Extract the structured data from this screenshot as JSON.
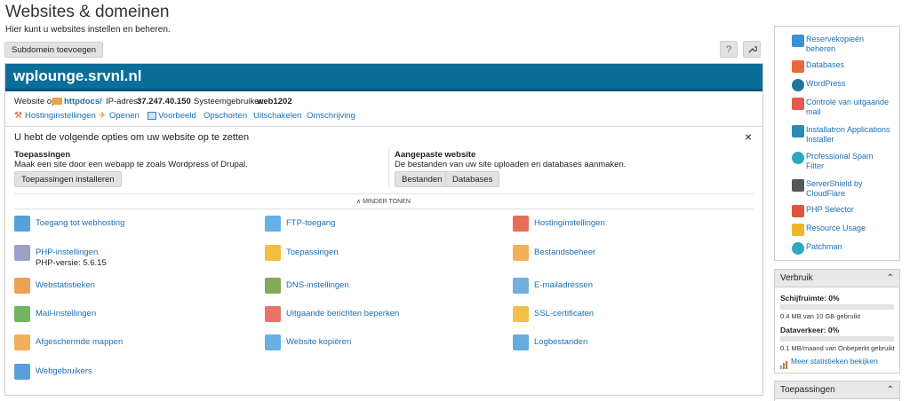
{
  "page": {
    "title": "Websites & domeinen",
    "subtitle": "Hier kunt u websites instellen en beheren."
  },
  "toolbar": {
    "add_subdomain_label": "Subdomein toevoegen",
    "help_label": "?",
    "tools_icon": "wrench-icon"
  },
  "domain": {
    "name": "wplounge.srvnl.nl",
    "website_on_label": "Website op",
    "docroot": "httpdocs/",
    "ip_label": "IP-adres:",
    "ip": "37.247.40.150",
    "sysuser_label": "Systeemgebruiker:",
    "sysuser": "web1202",
    "actions": [
      "Hostinginstellingen",
      "Openen",
      "Voorbeeld",
      "Opschorten",
      "Uitschakelen",
      "Omschrijving"
    ]
  },
  "setup": {
    "heading": "U hebt de volgende opties om uw website op te zetten",
    "close": "×",
    "apps_title": "Toepassingen",
    "apps_desc": "Maak een site door een webapp te zoals Wordpress of Drupal.",
    "apps_button": "Toepassingen installeren",
    "custom_title": "Aangepaste website",
    "custom_desc": "De bestanden van uw site uploaden en databases aanmaken.",
    "files_button": "Bestanden",
    "databases_button": "Databases",
    "less_label": "MINDER TONEN"
  },
  "features": [
    {
      "label": "Toegang tot webhosting",
      "icon": "globe-icon",
      "color": "#3b8fd4"
    },
    {
      "label": "FTP-toegang",
      "icon": "ftp-icon",
      "color": "#4aa3df"
    },
    {
      "label": "Hostinginstellingen",
      "icon": "hosting-icon",
      "color": "#e0553b"
    },
    {
      "label": "PHP-instellingen",
      "icon": "php-icon",
      "color": "#8892bf",
      "extra": "PHP-versie: 5.6.15"
    },
    {
      "label": "Toepassingen",
      "icon": "gear-icon",
      "color": "#f2b21b"
    },
    {
      "label": "Bestandsbeheer",
      "icon": "folder-icon",
      "color": "#f0a23c"
    },
    {
      "label": "Webstatistieken",
      "icon": "stats-icon",
      "color": "#e9913a"
    },
    {
      "label": "DNS-instellingen",
      "icon": "dns-icon",
      "color": "#6c9b3b"
    },
    {
      "label": "E-mailadressen",
      "icon": "email-icon",
      "color": "#5aa0d8"
    },
    {
      "label": "Mail-instellingen",
      "icon": "mail-settings-icon",
      "color": "#58a942"
    },
    {
      "label": "Uitgaande berichten beperken",
      "icon": "outgoing-mail-icon",
      "color": "#e65a4e"
    },
    {
      "label": "SSL-certificaten",
      "icon": "ssl-icon",
      "color": "#f0b429"
    },
    {
      "label": "Afgeschermde mappen",
      "icon": "protected-folder-icon",
      "color": "#f0a23c"
    },
    {
      "label": "Website kopiëren",
      "icon": "copy-icon",
      "color": "#4aa3df"
    },
    {
      "label": "Logbestanden",
      "icon": "log-icon",
      "color": "#4a9fd8"
    },
    {
      "label": "Webgebruikers",
      "icon": "web-users-icon",
      "color": "#3b8fd4"
    }
  ],
  "sidebar": {
    "items": [
      {
        "label": "Reservekopieën beheren",
        "icon": "backup-icon",
        "color": "#3b8fd4"
      },
      {
        "label": "Databases",
        "icon": "database-icon",
        "color": "#e9693b"
      },
      {
        "label": "WordPress",
        "icon": "wordpress-icon",
        "color": "#21759b"
      },
      {
        "label": "Controle van uitgaande mail",
        "icon": "mail-control-icon",
        "color": "#e65a4e"
      },
      {
        "label": "Installatron Applications Installer",
        "icon": "installatron-icon",
        "color": "#2a8ab8"
      },
      {
        "label": "Professional Spam Filter",
        "icon": "spam-filter-icon",
        "color": "#2fa8c4"
      },
      {
        "label": "ServerShield by CloudFlare",
        "icon": "cloudflare-icon",
        "color": "#555555"
      },
      {
        "label": "PHP Selector",
        "icon": "php-selector-icon",
        "color": "#e0553b"
      },
      {
        "label": "Resource Usage",
        "icon": "resource-usage-icon",
        "color": "#f0b429"
      },
      {
        "label": "Patchman",
        "icon": "patchman-icon",
        "color": "#2fa8c4"
      }
    ]
  },
  "usage": {
    "title": "Verbruik",
    "disk_label": "Schijfruimte: 0%",
    "disk_used": "0.4 MB van 10 GB gebruikt",
    "disk_fraction": 0,
    "traffic_label": "Dataverkeer: 0%",
    "traffic_used": "0.1 MB/maand van Onbeperkt gebruikt",
    "traffic_fraction": 0,
    "more_link": "Meer statistieken bekijken"
  },
  "apps_card": {
    "title": "Toepassingen"
  }
}
